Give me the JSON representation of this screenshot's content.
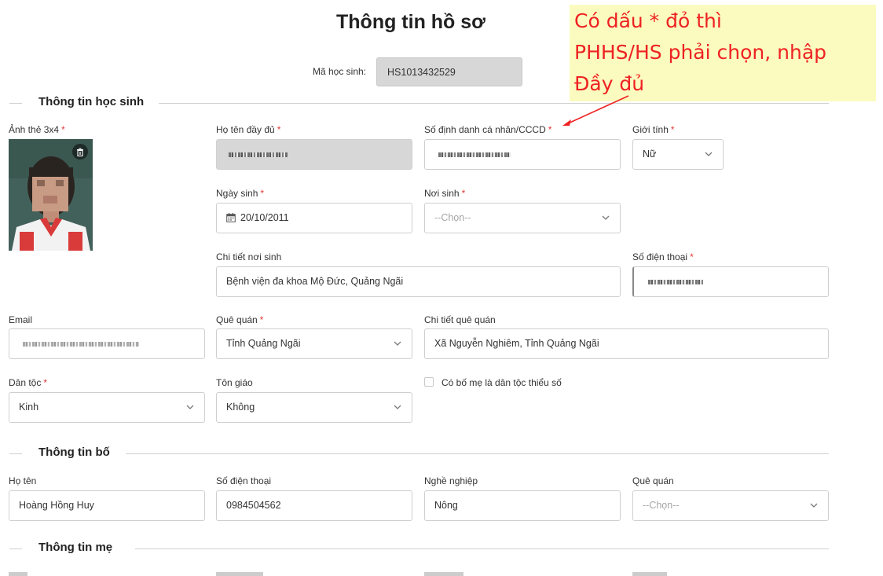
{
  "page_title": "Thông tin hồ sơ",
  "student_id": {
    "label": "Mã học sinh:",
    "value": "HS1013432529"
  },
  "callout": {
    "line1": "Có dấu * đỏ thì",
    "line2": "PHHS/HS phải chọn, nhập",
    "line3": "Đầy đủ"
  },
  "sections": {
    "student": "Thông tin học sinh",
    "father": "Thông tin bố",
    "mother": "Thông tin mẹ"
  },
  "required_mark": "*",
  "student": {
    "photo_label": "Ảnh thẻ 3x4",
    "full_name_label": "Họ tên đầy đủ",
    "id_number_label": "Số định danh cá nhân/CCCD",
    "gender_label": "Giới tính",
    "gender_value": "Nữ",
    "dob_label": "Ngày sinh",
    "dob_value": "20/10/2011",
    "birthplace_label": "Nơi sinh",
    "birthplace_placeholder": "--Chọn--",
    "birthplace_detail_label": "Chi tiết nơi sinh",
    "birthplace_detail_value": "Bệnh viện đa khoa Mộ Đức, Quảng Ngãi",
    "phone_label": "Số điện thoại",
    "email_label": "Email",
    "hometown_label": "Quê quán",
    "hometown_value": "Tỉnh Quảng Ngãi",
    "hometown_detail_label": "Chi tiết quê quán",
    "hometown_detail_value": "Xã Nguyễn Nghiêm, Tỉnh Quảng Ngãi",
    "ethnicity_label": "Dân tộc",
    "ethnicity_value": "Kinh",
    "religion_label": "Tôn giáo",
    "religion_value": "Không",
    "minority_parent_label": "Có bố mẹ là dân tộc thiểu số"
  },
  "father": {
    "name_label": "Họ tên",
    "name_value": "Hoàng Hồng Huy",
    "phone_label": "Số điện thoại",
    "phone_value": "0984504562",
    "job_label": "Nghề nghiệp",
    "job_value": "Nông",
    "hometown_label": "Quê quán",
    "hometown_placeholder": "--Chọn--"
  },
  "colors": {
    "required": "#e53935",
    "callout_bg": "#fbfbbf",
    "callout_text": "#ee2222",
    "disabled_bg": "#d7d7d7"
  },
  "icons": [
    "trash-icon",
    "calendar-icon",
    "chevron-down-icon",
    "arrow-annotation"
  ]
}
